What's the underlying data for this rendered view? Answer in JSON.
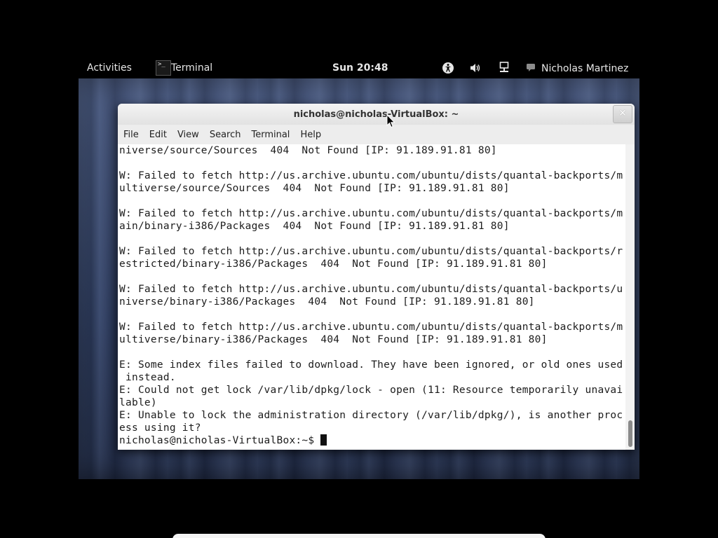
{
  "top_panel": {
    "activities_label": "Activities",
    "app_icon_glyph": ">_",
    "app_name": "Terminal",
    "clock": "Sun 20:48",
    "user_name": "Nicholas Martinez",
    "icons": [
      "accessibility-icon",
      "volume-icon",
      "network-icon",
      "chat-status-icon"
    ]
  },
  "window": {
    "title": "nicholas@nicholas-VirtualBox: ~",
    "close_glyph": "✕",
    "menus": [
      "File",
      "Edit",
      "View",
      "Search",
      "Terminal",
      "Help"
    ]
  },
  "terminal": {
    "lines": [
      "niverse/source/Sources  404  Not Found [IP: 91.189.91.81 80]",
      "",
      "W: Failed to fetch http://us.archive.ubuntu.com/ubuntu/dists/quantal-backports/m",
      "ultiverse/source/Sources  404  Not Found [IP: 91.189.91.81 80]",
      "",
      "W: Failed to fetch http://us.archive.ubuntu.com/ubuntu/dists/quantal-backports/m",
      "ain/binary-i386/Packages  404  Not Found [IP: 91.189.91.81 80]",
      "",
      "W: Failed to fetch http://us.archive.ubuntu.com/ubuntu/dists/quantal-backports/r",
      "estricted/binary-i386/Packages  404  Not Found [IP: 91.189.91.81 80]",
      "",
      "W: Failed to fetch http://us.archive.ubuntu.com/ubuntu/dists/quantal-backports/u",
      "niverse/binary-i386/Packages  404  Not Found [IP: 91.189.91.81 80]",
      "",
      "W: Failed to fetch http://us.archive.ubuntu.com/ubuntu/dists/quantal-backports/m",
      "ultiverse/binary-i386/Packages  404  Not Found [IP: 91.189.91.81 80]",
      "",
      "E: Some index files failed to download. They have been ignored, or old ones used",
      " instead.",
      "E: Could not get lock /var/lib/dpkg/lock - open (11: Resource temporarily unavai",
      "lable)",
      "E: Unable to lock the administration directory (/var/lib/dpkg/), is another proc",
      "ess using it?"
    ],
    "prompt": "nicholas@nicholas-VirtualBox:~$ "
  },
  "colors": {
    "desktop_bg": "#34446a",
    "terminal_bg": "#ffffff",
    "terminal_fg": "#1c1c1c",
    "panel_bg": "#000000",
    "panel_fg": "#e6e6e6"
  }
}
